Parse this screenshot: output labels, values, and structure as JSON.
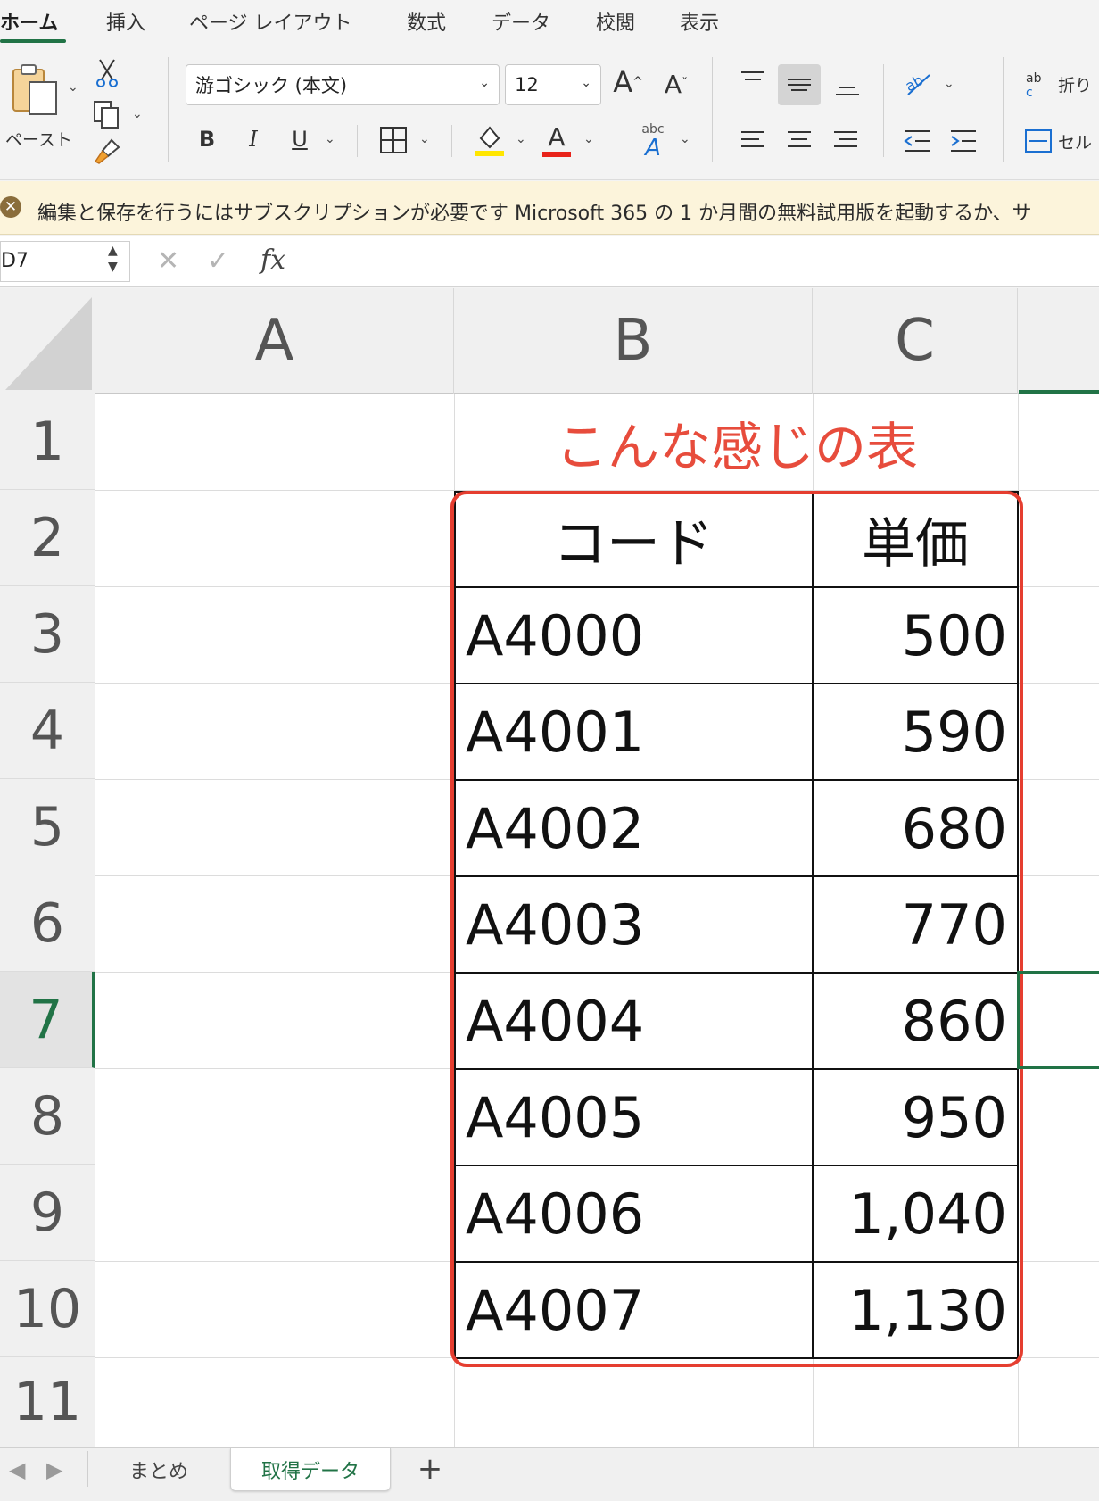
{
  "ribbon_tabs": [
    "ホーム",
    "挿入",
    "ページ レイアウト",
    "数式",
    "データ",
    "校閲",
    "表示"
  ],
  "ribbon": {
    "paste_label": "ペースト",
    "font_name": "游ゴシック (本文)",
    "font_size": "12",
    "bold": "B",
    "italic": "I",
    "underline": "U",
    "grow_font": "A",
    "shrink_font": "A",
    "font_color_glyph": "A",
    "phonetic": "abc",
    "wrap_text": "折り",
    "merge": "セル",
    "accent_color": "#217346",
    "highlight_color": "#ffe600",
    "font_color": "#e8231a"
  },
  "banner": {
    "text": "編集と保存を行うにはサブスクリプションが必要です  Microsoft 365 の 1 か月間の無料試用版を起動するか、サ"
  },
  "formula_bar": {
    "name_box": "D7",
    "cancel": "✕",
    "enter": "✓",
    "fx": "fx",
    "value": ""
  },
  "columns": [
    "A",
    "B",
    "C"
  ],
  "rows": [
    "1",
    "2",
    "3",
    "4",
    "5",
    "6",
    "7",
    "8",
    "9",
    "10",
    "11"
  ],
  "selected_row": "7",
  "sheet": {
    "title": "こんな感じの表",
    "header_code": "コード",
    "header_price": "単価",
    "data": [
      {
        "code": "A4000",
        "price": "500"
      },
      {
        "code": "A4001",
        "price": "590"
      },
      {
        "code": "A4002",
        "price": "680"
      },
      {
        "code": "A4003",
        "price": "770"
      },
      {
        "code": "A4004",
        "price": "860"
      },
      {
        "code": "A4005",
        "price": "950"
      },
      {
        "code": "A4006",
        "price": "1,040"
      },
      {
        "code": "A4007",
        "price": "1,130"
      }
    ]
  },
  "sheet_tabs": [
    "まとめ",
    "取得データ"
  ],
  "active_sheet": "取得データ",
  "add_sheet": "+"
}
